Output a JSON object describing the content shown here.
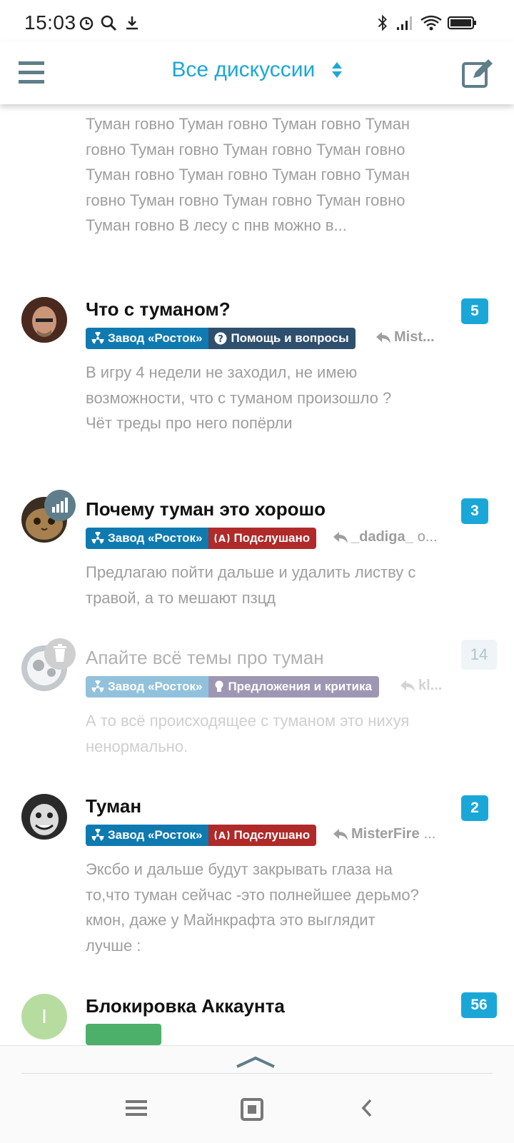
{
  "status_bar": {
    "time": "15:03"
  },
  "header": {
    "title": "Все дискуссии"
  },
  "top_excerpt": "Туман говно Туман говно Туман говно Туман говно Туман говно Туман говно Туман говно Туман говно Туман говно Туман говно Туман говно Туман говно Туман говно Туман говно Туман говно В лесу с пнв можно в...",
  "discussions": [
    {
      "title": "Что с туманом?",
      "count": "5",
      "tag1": "Завод «Росток»",
      "tag2": "Помощь и вопросы",
      "last_user": "Mist...",
      "excerpt": "В игру 4 недели не заходил, не имею возможности, что с туманом произошло ? Чёт треды про него попёрли"
    },
    {
      "title": "Почему туман это хорошо",
      "count": "3",
      "tag1": "Завод «Росток»",
      "tag2": "Подслушано",
      "last_user": "_dadiga_",
      "last_suffix": "о...",
      "excerpt": "Предлагаю пойти дальше и удалить листву с травой, а то мешают пзцд"
    },
    {
      "title": "Апайте всё темы про туман",
      "count": "14",
      "tag1": "Завод «Росток»",
      "tag2": "Предложения и критика",
      "last_user": "kl...",
      "excerpt": "А то всё происходящее с туманом это нихуя ненормально."
    },
    {
      "title": "Туман",
      "count": "2",
      "tag1": "Завод «Росток»",
      "tag2": "Подслушано",
      "last_user": "MisterFire",
      "last_suffix": "...",
      "excerpt": "Эксбо и дальше будут закрывать глаза на то,что туман сейчас -это полнейшее дерьмо?кмон, даже у Майнкрафта это выглядит лучше :"
    },
    {
      "title": "Блокировка Аккаунта",
      "count": "56",
      "avatar_letter": "I"
    }
  ],
  "colors": {
    "accent": "#1aa7d8",
    "tag_zavod": "#0f7ab0",
    "tag_help": "#2f4f6f",
    "tag_podslushano": "#b02a2a",
    "tag_predlozheniya": "#8a6fb0"
  }
}
